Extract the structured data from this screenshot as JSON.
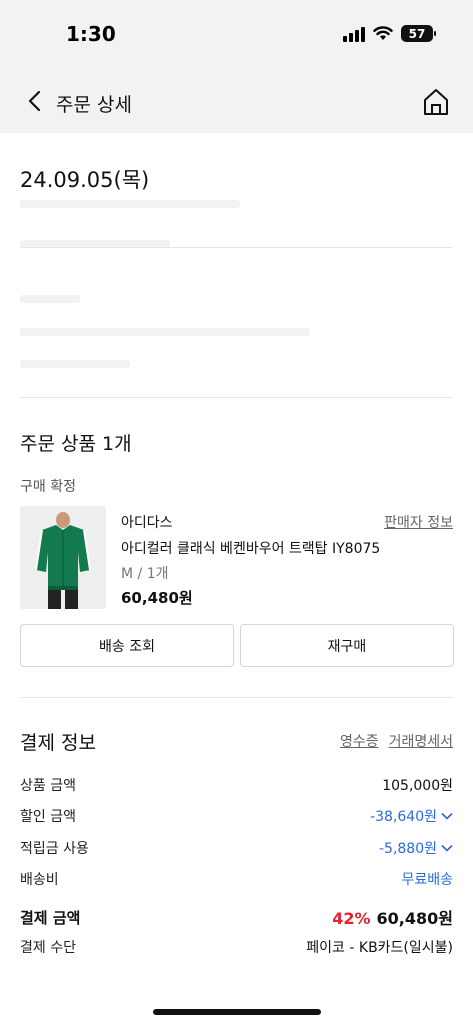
{
  "status": {
    "time": "1:30",
    "battery": "57"
  },
  "nav": {
    "title": "주문 상세"
  },
  "order": {
    "date": "24.09.05(목)"
  },
  "products": {
    "title": "주문 상품 1개",
    "status": "구매 확정",
    "brand": "아디다스",
    "seller_link": "판매자 정보",
    "name": "아디컬러 클래식 베켄바우어 트랙탑 IY8075",
    "option": "M / 1개",
    "price": "60,480원",
    "btn_track": "배송 조회",
    "btn_rebuy": "재구매"
  },
  "payment": {
    "title": "결제 정보",
    "receipt": "영수증",
    "statement": "거래명세서",
    "rows": [
      {
        "label": "상품 금액",
        "value": "105,000원"
      },
      {
        "label": "할인 금액",
        "value": "-38,640원"
      },
      {
        "label": "적립금 사용",
        "value": "-5,880원"
      },
      {
        "label": "배송비",
        "value": "무료배송"
      }
    ],
    "total_label": "결제 금액",
    "total_pct": "42%",
    "total_value": "60,480원",
    "method_label": "결제 수단",
    "method_value": "페이코 - KB카드(일시불)"
  },
  "colors": {
    "accent_blue": "#2a6ad9",
    "discount_red": "#e8222e",
    "jacket_green": "#127a4e"
  }
}
